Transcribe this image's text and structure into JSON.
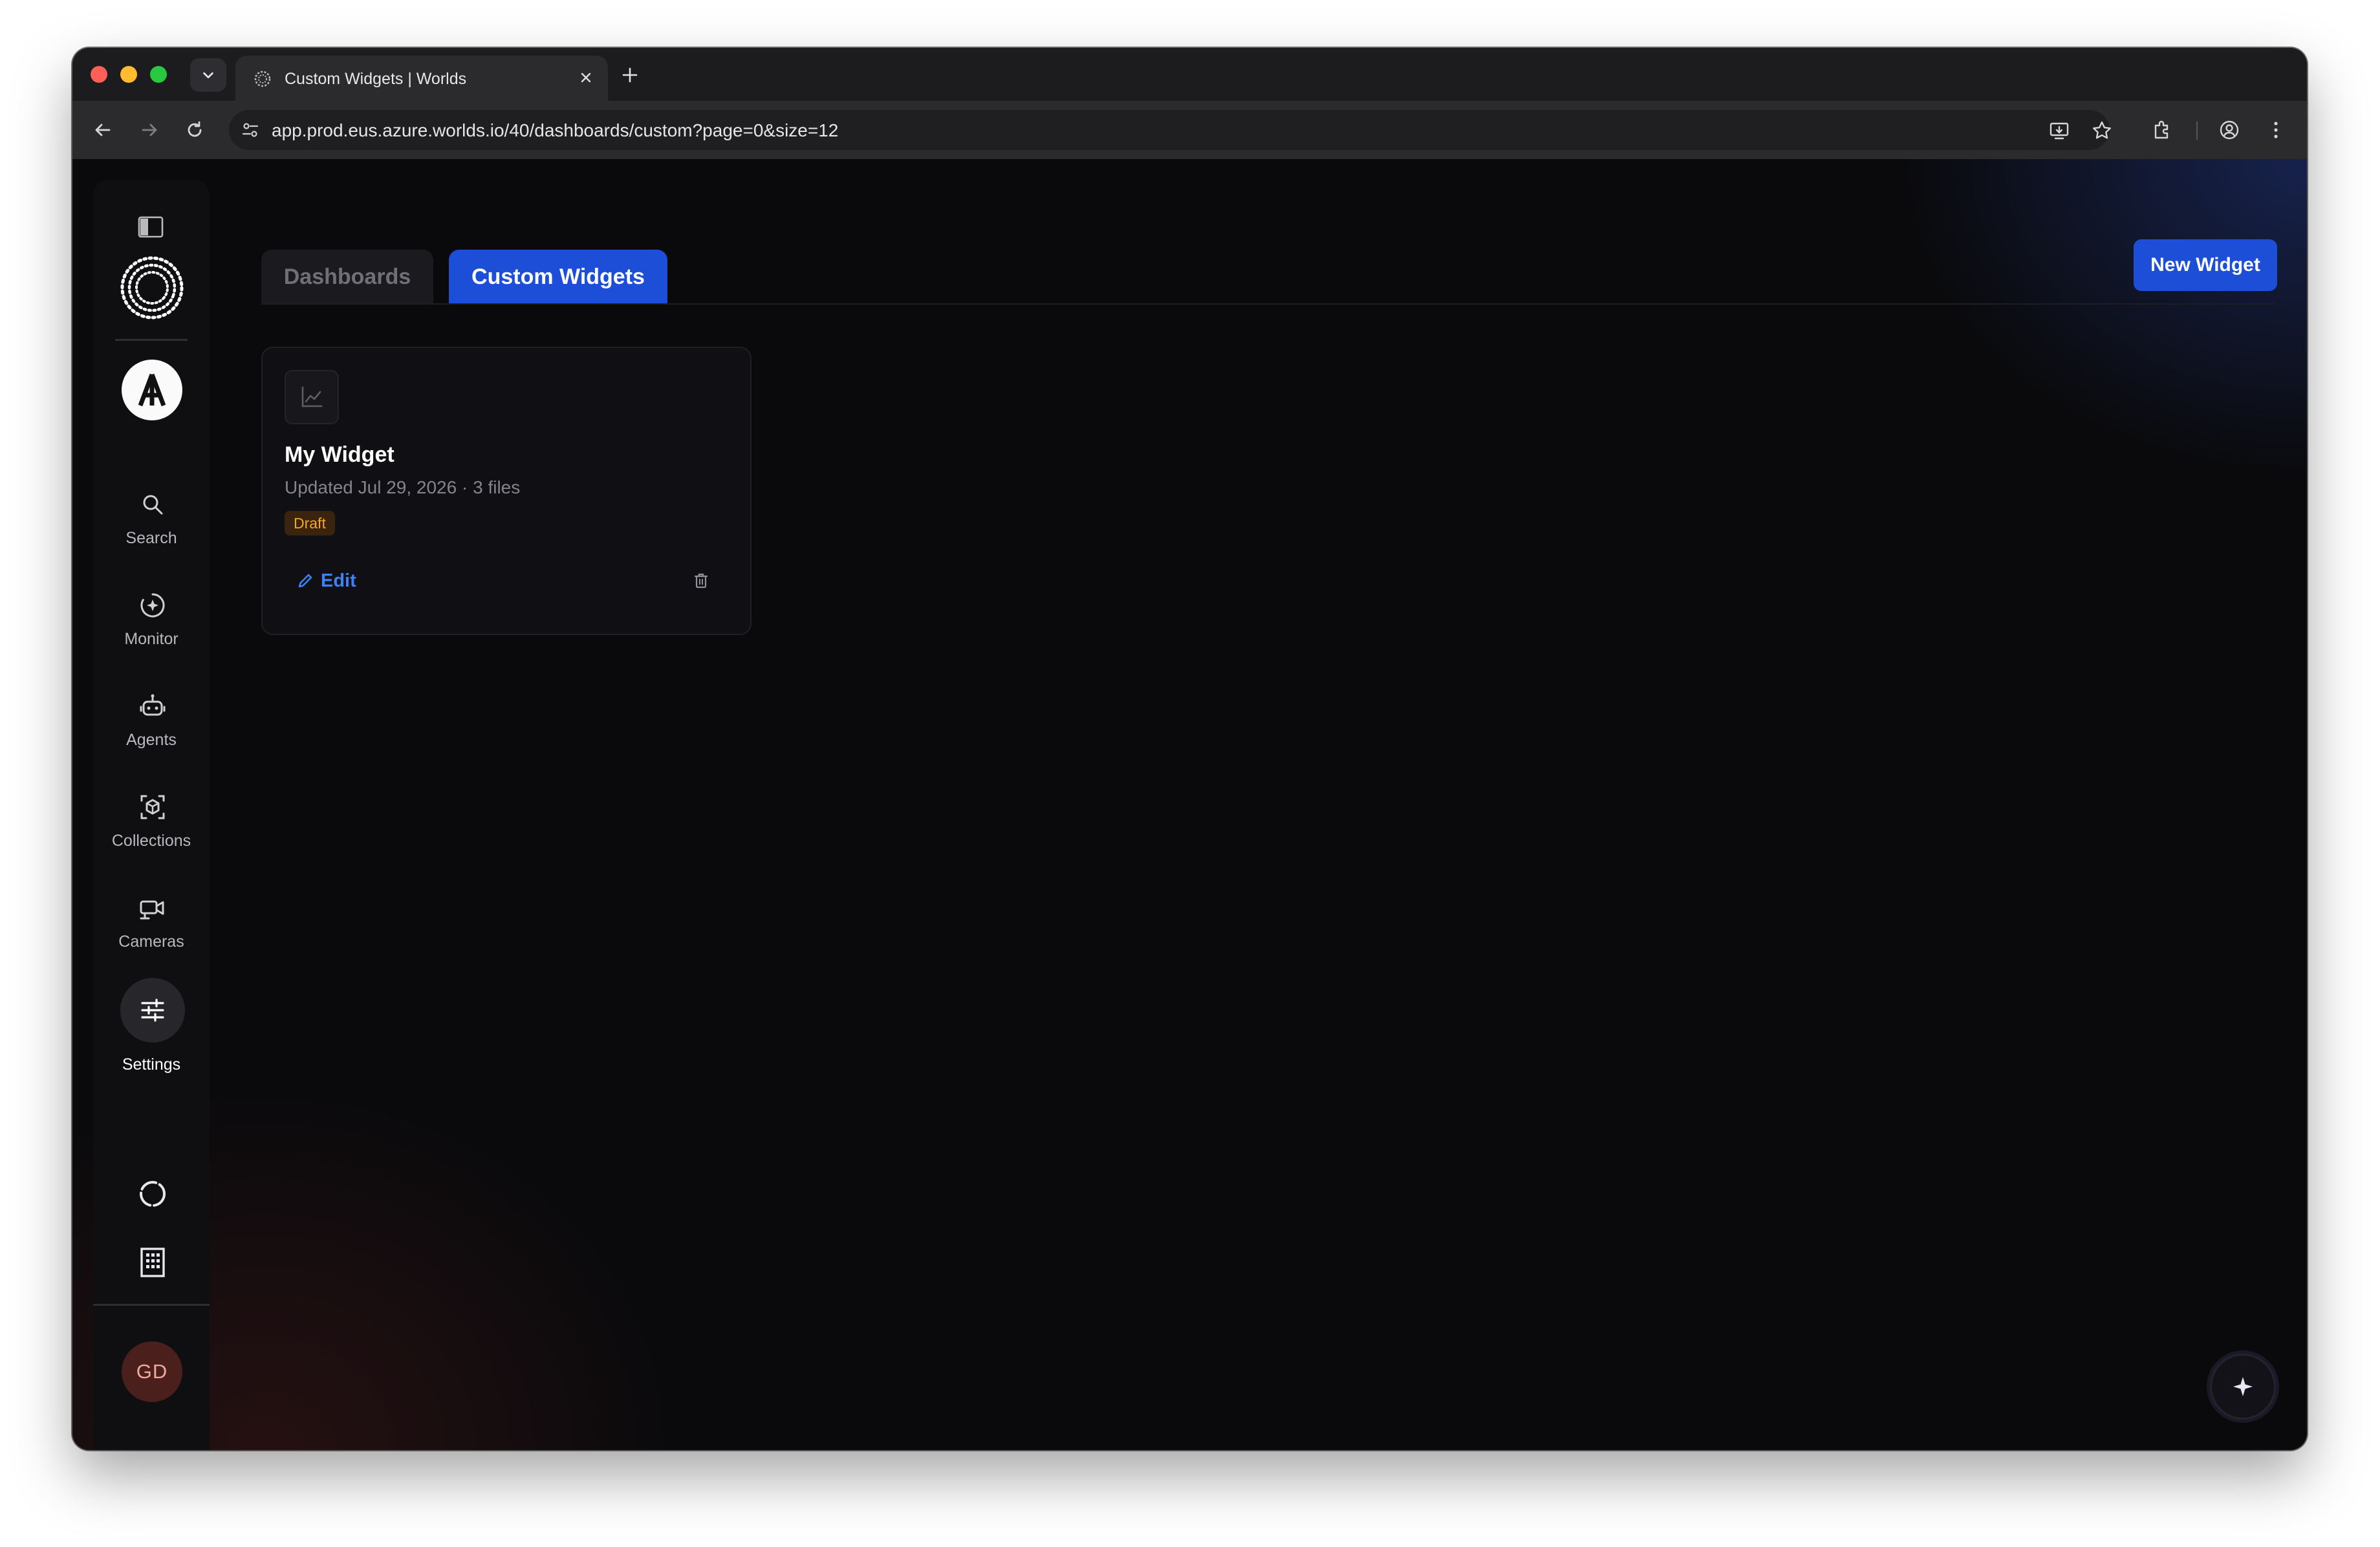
{
  "browser": {
    "tab_title": "Custom Widgets | Worlds",
    "url": "app.prod.eus.azure.worlds.io/40/dashboards/custom?page=0&size=12"
  },
  "sidebar": {
    "items": [
      {
        "label": "Search",
        "icon": "search-icon"
      },
      {
        "label": "Monitor",
        "icon": "monitor-icon"
      },
      {
        "label": "Agents",
        "icon": "robot-icon"
      },
      {
        "label": "Collections",
        "icon": "collections-icon"
      },
      {
        "label": "Cameras",
        "icon": "camera-icon"
      },
      {
        "label": "Settings",
        "icon": "sliders-icon"
      }
    ],
    "active": "Settings",
    "avatar_initials": "GD"
  },
  "main": {
    "tabs": [
      {
        "label": "Dashboards",
        "active": false
      },
      {
        "label": "Custom Widgets",
        "active": true
      }
    ],
    "new_widget_label": "New Widget"
  },
  "widgets": [
    {
      "name": "My Widget",
      "meta": "Updated Jul 29, 2026 · 3 files",
      "status": "Draft",
      "edit_label": "Edit"
    }
  ],
  "colors": {
    "accent": "#1d4ed8",
    "link": "#3b82f6",
    "draft_badge": "#f5a623",
    "background": "#0a0a0c"
  }
}
